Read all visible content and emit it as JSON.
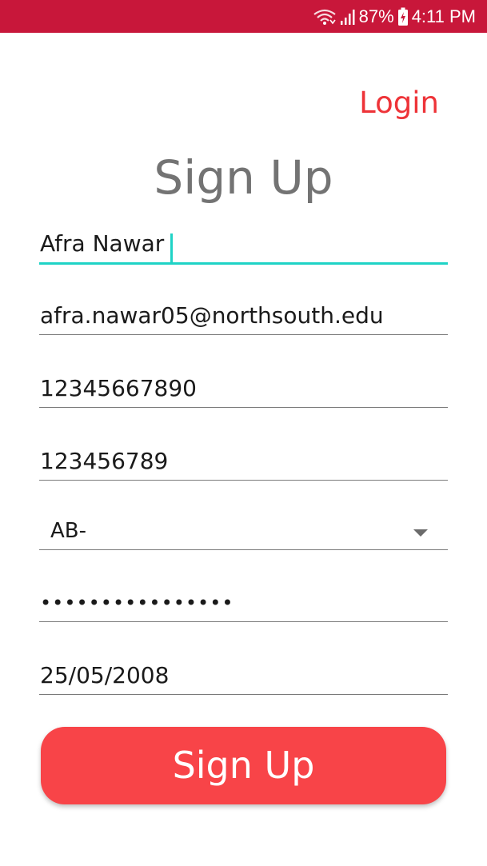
{
  "status_bar": {
    "battery": "87%",
    "time": "4:11 PM",
    "icons": [
      "wifi-icon",
      "signal-icon",
      "battery-charging-icon"
    ]
  },
  "header": {
    "login_label": "Login",
    "title": "Sign Up"
  },
  "form": {
    "name": "Afra Nawar",
    "email": "afra.nawar05@northsouth.edu",
    "phone": "12345667890",
    "id": "123456789",
    "blood_group": "AB-",
    "password": "••••••••••••••••",
    "dob": "25/05/2008"
  },
  "actions": {
    "signup_label": "Sign Up"
  },
  "colors": {
    "status_bar": "#c8173a",
    "accent": "#f84448",
    "focus": "#1fd3c6",
    "title": "#737373"
  }
}
